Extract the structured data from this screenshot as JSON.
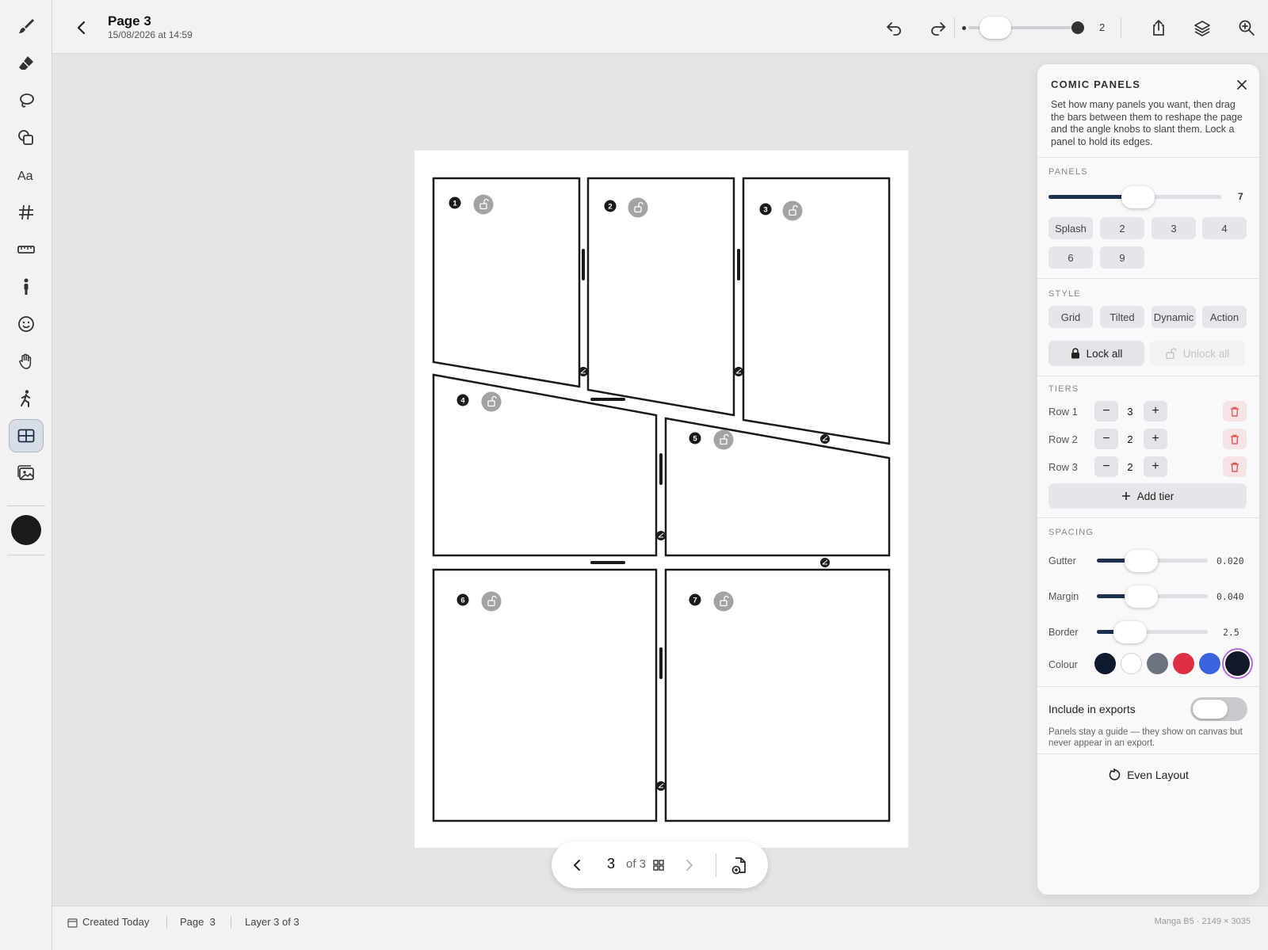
{
  "header": {
    "title": "Page 3",
    "date": "15/08/2026 at 14:59",
    "brush_size": "2"
  },
  "toolbar": {
    "tools": [
      "brush-icon",
      "eraser-icon",
      "lasso-icon",
      "shapes-icon",
      "text-icon",
      "grid-icon",
      "ruler-icon",
      "figure-icon",
      "emoji-icon",
      "hand-icon",
      "pose-icon",
      "comic-panels-icon",
      "image-icon"
    ],
    "active_tool": "comic-panels-icon",
    "current_color": "#1a1a1a"
  },
  "canvas": {
    "panel_numbers": [
      "1",
      "2",
      "3",
      "4",
      "5",
      "6",
      "7"
    ],
    "border_color": "#1a1a1a"
  },
  "pager": {
    "current": "3",
    "of_label": "of 3"
  },
  "status": {
    "created": "Created Today",
    "page": "Page  3",
    "layer": "Layer 3 of 3",
    "format": "Manga B5 · 2149 × 3035"
  },
  "comic_panels": {
    "title": "COMIC PANELS",
    "description": "Set how many panels you want, then drag the bars between them to reshape the page and the angle knobs to slant them. Lock a panel to hold its edges.",
    "panels_section": "PANELS",
    "panel_count": 7,
    "panel_count_label": "7",
    "panel_count_fraction": 0.52,
    "presets": [
      "Splash",
      "2",
      "3",
      "4",
      "6",
      "9"
    ],
    "style_section": "STYLE",
    "styles": [
      "Grid",
      "Tilted",
      "Dynamic",
      "Action"
    ],
    "lock_all": "Lock all",
    "unlock_all": "Unlock all",
    "tiers_section": "TIERS",
    "tiers": [
      {
        "label": "Row 1",
        "count": "3"
      },
      {
        "label": "Row 2",
        "count": "2"
      },
      {
        "label": "Row 3",
        "count": "2"
      }
    ],
    "add_tier": "Add tier",
    "spacing_section": "SPACING",
    "gutter_label": "Gutter",
    "gutter_value": "0.020",
    "gutter_fraction": 0.4,
    "margin_label": "Margin",
    "margin_value": "0.040",
    "margin_fraction": 0.4,
    "border_label": "Border",
    "border_value": "2.5",
    "border_fraction": 0.3,
    "colour_label": "Colour",
    "colours": [
      "#0f1a2e",
      "#ffffff",
      "#6b7280",
      "#dc2f44",
      "#3a63dd",
      "#111827"
    ],
    "selected_colour_index": 5,
    "include_label": "Include in exports",
    "include_enabled": false,
    "include_note": "Panels stay a guide — they show on canvas but never appear in an export.",
    "even_layout": "Even Layout"
  }
}
